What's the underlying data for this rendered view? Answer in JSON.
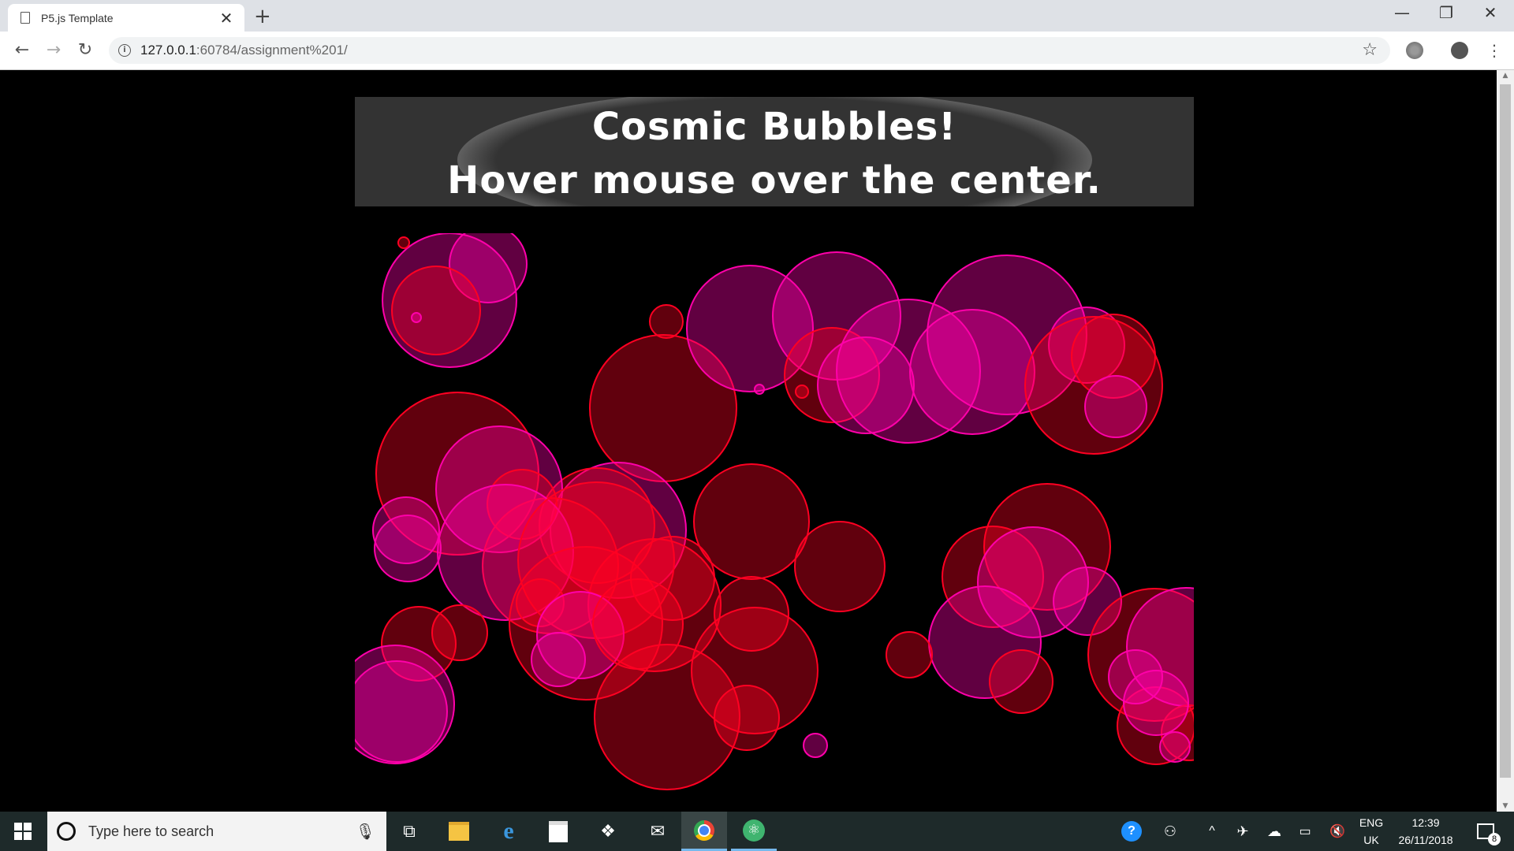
{
  "browser": {
    "tab_title": "P5.js Template",
    "new_tab": "+",
    "url_host": "127.0.0.1",
    "url_path": ":60784/assignment%201/"
  },
  "banner": {
    "line1": "Cosmic Bubbles!",
    "line2": "Hover mouse over the center."
  },
  "bubble_colors": {
    "magenta": "#ff00aa",
    "red": "#ff0022",
    "purple": "#cc0077"
  },
  "taskbar": {
    "search_placeholder": "Type here to search",
    "lang_top": "ENG",
    "lang_bottom": "UK",
    "time": "12:39",
    "date": "26/11/2018",
    "notification_count": "8"
  }
}
